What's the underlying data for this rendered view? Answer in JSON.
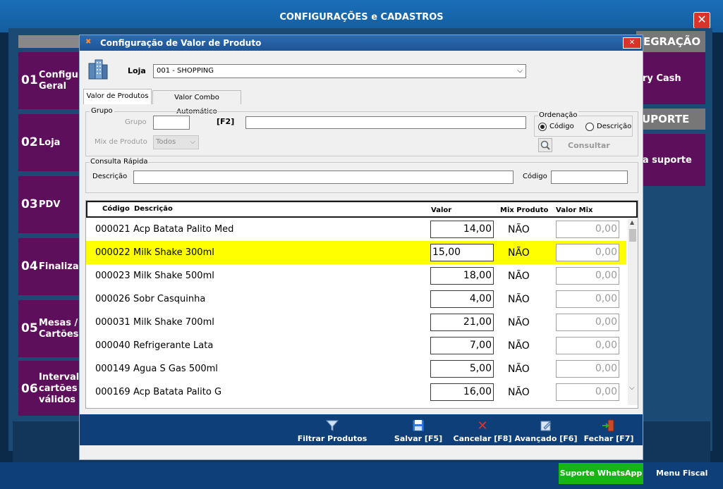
{
  "outer": {
    "title": "CONFIGURAÇÕES e CADASTROS",
    "sidebar": [
      {
        "num": "01",
        "label": "Configur\nGeral"
      },
      {
        "num": "02",
        "label": "Loja"
      },
      {
        "num": "03",
        "label": "PDV"
      },
      {
        "num": "04",
        "label": "Finalizad"
      },
      {
        "num": "05",
        "label": "Mesas /\nCartões"
      },
      {
        "num": "06",
        "label": "Intervalo\ncartões\nválidos"
      }
    ],
    "right_panel": {
      "integration_header": "EGRAÇÃO",
      "integration_item": "ory Cash",
      "support_header": "UPORTE",
      "support_item": "ea suporte"
    },
    "footer": {
      "whatsapp": "Suporte WhatsApp",
      "menu_fiscal": "Menu Fiscal"
    },
    "colors": {
      "sidebar": "#5d0f5c",
      "title_bar": "#1a6fb8",
      "whatsapp": "#15b515"
    }
  },
  "dialog": {
    "title": "Configuração de Valor de Produto",
    "loja_label": "Loja",
    "loja_value": "001 - SHOPPING",
    "tabs": [
      {
        "label": "Valor de Produtos",
        "active": true
      },
      {
        "label": "Valor Combo Automático",
        "active": false
      }
    ],
    "grupo_box": {
      "title": "Grupo",
      "grupo_label": "Grupo",
      "grupo_value": "",
      "f2_label": "[F2]",
      "grupo_desc_value": "",
      "mix_label": "Mix de Produto",
      "mix_value": "Todos"
    },
    "ordenacao": {
      "title": "Ordenação",
      "options": [
        "Código",
        "Descrição"
      ],
      "selected": "Código"
    },
    "consultar_label": "Consultar",
    "consulta_rapida": {
      "title": "Consulta Rápida",
      "descricao_label": "Descrição",
      "descricao_value": "",
      "codigo_label": "Código",
      "codigo_value": ""
    },
    "grid": {
      "headers": {
        "codigo": "Código",
        "descricao": "Descrição",
        "valor": "Valor",
        "mix": "Mix Produto",
        "valor_mix": "Valor Mix"
      },
      "rows": [
        {
          "codigo": "000021",
          "descricao": "Acp Batata Palito Med",
          "valor": "14,00",
          "mix": "NÃO",
          "valor_mix": "0,00",
          "selected": false
        },
        {
          "codigo": "000022",
          "descricao": "Milk Shake 300ml",
          "valor": "15,00",
          "mix": "NÃO",
          "valor_mix": "0,00",
          "selected": true
        },
        {
          "codigo": "000023",
          "descricao": "Milk Shake 500ml",
          "valor": "18,00",
          "mix": "NÃO",
          "valor_mix": "0,00",
          "selected": false
        },
        {
          "codigo": "000026",
          "descricao": "Sobr Casquinha",
          "valor": "4,00",
          "mix": "NÃO",
          "valor_mix": "0,00",
          "selected": false
        },
        {
          "codigo": "000031",
          "descricao": "Milk Shake 700ml",
          "valor": "21,00",
          "mix": "NÃO",
          "valor_mix": "0,00",
          "selected": false
        },
        {
          "codigo": "000040",
          "descricao": "Refrigerante Lata",
          "valor": "7,00",
          "mix": "NÃO",
          "valor_mix": "0,00",
          "selected": false
        },
        {
          "codigo": "000149",
          "descricao": "Agua S Gas 500ml",
          "valor": "5,00",
          "mix": "NÃO",
          "valor_mix": "0,00",
          "selected": false
        },
        {
          "codigo": "000169",
          "descricao": "Acp Batata Palito G",
          "valor": "16,00",
          "mix": "NÃO",
          "valor_mix": "0,00",
          "selected": false
        }
      ]
    },
    "toolbar": {
      "filtrar": "Filtrar Produtos",
      "salvar": "Salvar [F5]",
      "cancelar": "Cancelar [F8]",
      "avancado": "Avançado [F6]",
      "fechar": "Fechar [F7]"
    }
  }
}
